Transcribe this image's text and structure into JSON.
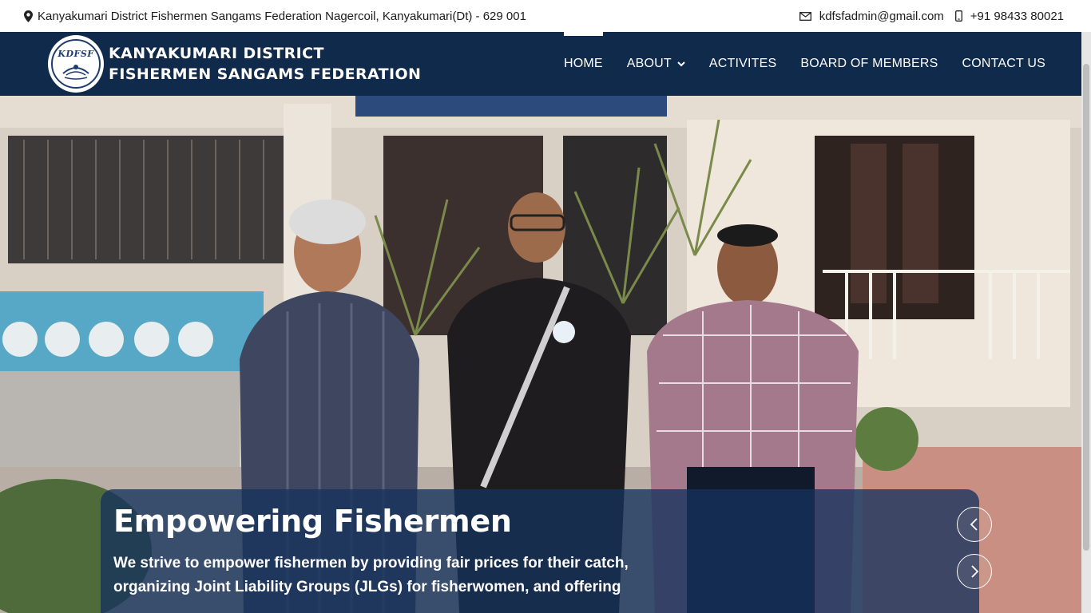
{
  "topbar": {
    "address": "Kanyakumari District Fishermen Sangams Federation Nagercoil, Kanyakumari(Dt) - 629 001",
    "email": "kdfsfadmin@gmail.com",
    "phone": "+91 98433 80021",
    "icons": [
      "location-pin-icon",
      "mail-icon",
      "phone-icon"
    ]
  },
  "header": {
    "logo_abbr": "KDFSF",
    "logo_line1": "KANYAKUMARI DISTRICT",
    "logo_line2": "FISHERMEN SANGAMS FEDERATION",
    "nav": [
      {
        "label": "HOME",
        "active": true
      },
      {
        "label": "ABOUT",
        "has_dropdown": true
      },
      {
        "label": "ACTIVITES"
      },
      {
        "label": "BOARD OF MEMBERS"
      },
      {
        "label": "CONTACT US"
      }
    ]
  },
  "hero": {
    "image_alt": "Three men standing in front of a building",
    "title": "Empowering Fishermen",
    "text": "We strive to empower fishermen by providing fair prices for their catch, organizing Joint Liability Groups (JLGs) for fisherwomen, and offering",
    "prev_icon": "chevron-left-icon",
    "next_icon": "chevron-right-icon"
  },
  "colors": {
    "header_bg": "#102a4c",
    "caption_bg": "#16325c",
    "text_dark": "#1b1b1b"
  }
}
